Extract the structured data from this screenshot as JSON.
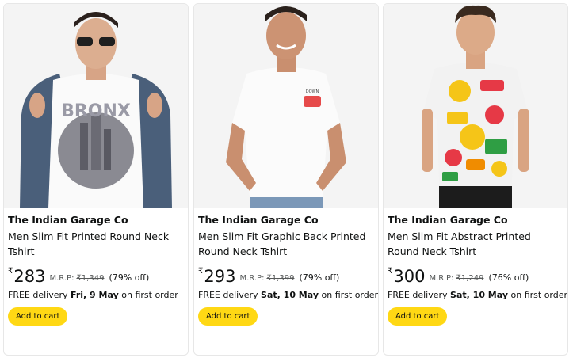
{
  "products": [
    {
      "brand": "The Indian Garage Co",
      "title": "Men Slim Fit Printed Round Neck Tshirt",
      "currency": "₹",
      "price": "283",
      "mrp_label": "M.R.P:",
      "mrp": "₹1,349",
      "discount": "(79% off)",
      "delivery_prefix": "FREE delivery",
      "delivery_date": "Fri, 9 May",
      "delivery_suffix": "on first order",
      "cart_label": "Add to cart",
      "image": "man-white-printed-tshirt-denim-jacket"
    },
    {
      "brand": "The Indian Garage Co",
      "title": "Men Slim Fit Graphic Back Printed Round Neck Tshirt",
      "currency": "₹",
      "price": "293",
      "mrp_label": "M.R.P:",
      "mrp": "₹1,399",
      "discount": "(79% off)",
      "delivery_prefix": "FREE delivery",
      "delivery_date": "Sat, 10 May",
      "delivery_suffix": "on first order",
      "cart_label": "Add to cart",
      "image": "man-white-tshirt-chest-logo"
    },
    {
      "brand": "The Indian Garage Co",
      "title": "Men Slim Fit Abstract Printed Round Neck Tshirt",
      "currency": "₹",
      "price": "300",
      "mrp_label": "M.R.P:",
      "mrp": "₹1,249",
      "discount": "(76% off)",
      "delivery_prefix": "FREE delivery",
      "delivery_date": "Sat, 10 May",
      "delivery_suffix": "on first order",
      "cart_label": "Add to cart",
      "image": "man-sticker-print-tshirt"
    }
  ],
  "colors": {
    "cart_button": "#ffd814",
    "text": "#0f1111",
    "muted": "#565959",
    "border": "#e7e7e7"
  }
}
